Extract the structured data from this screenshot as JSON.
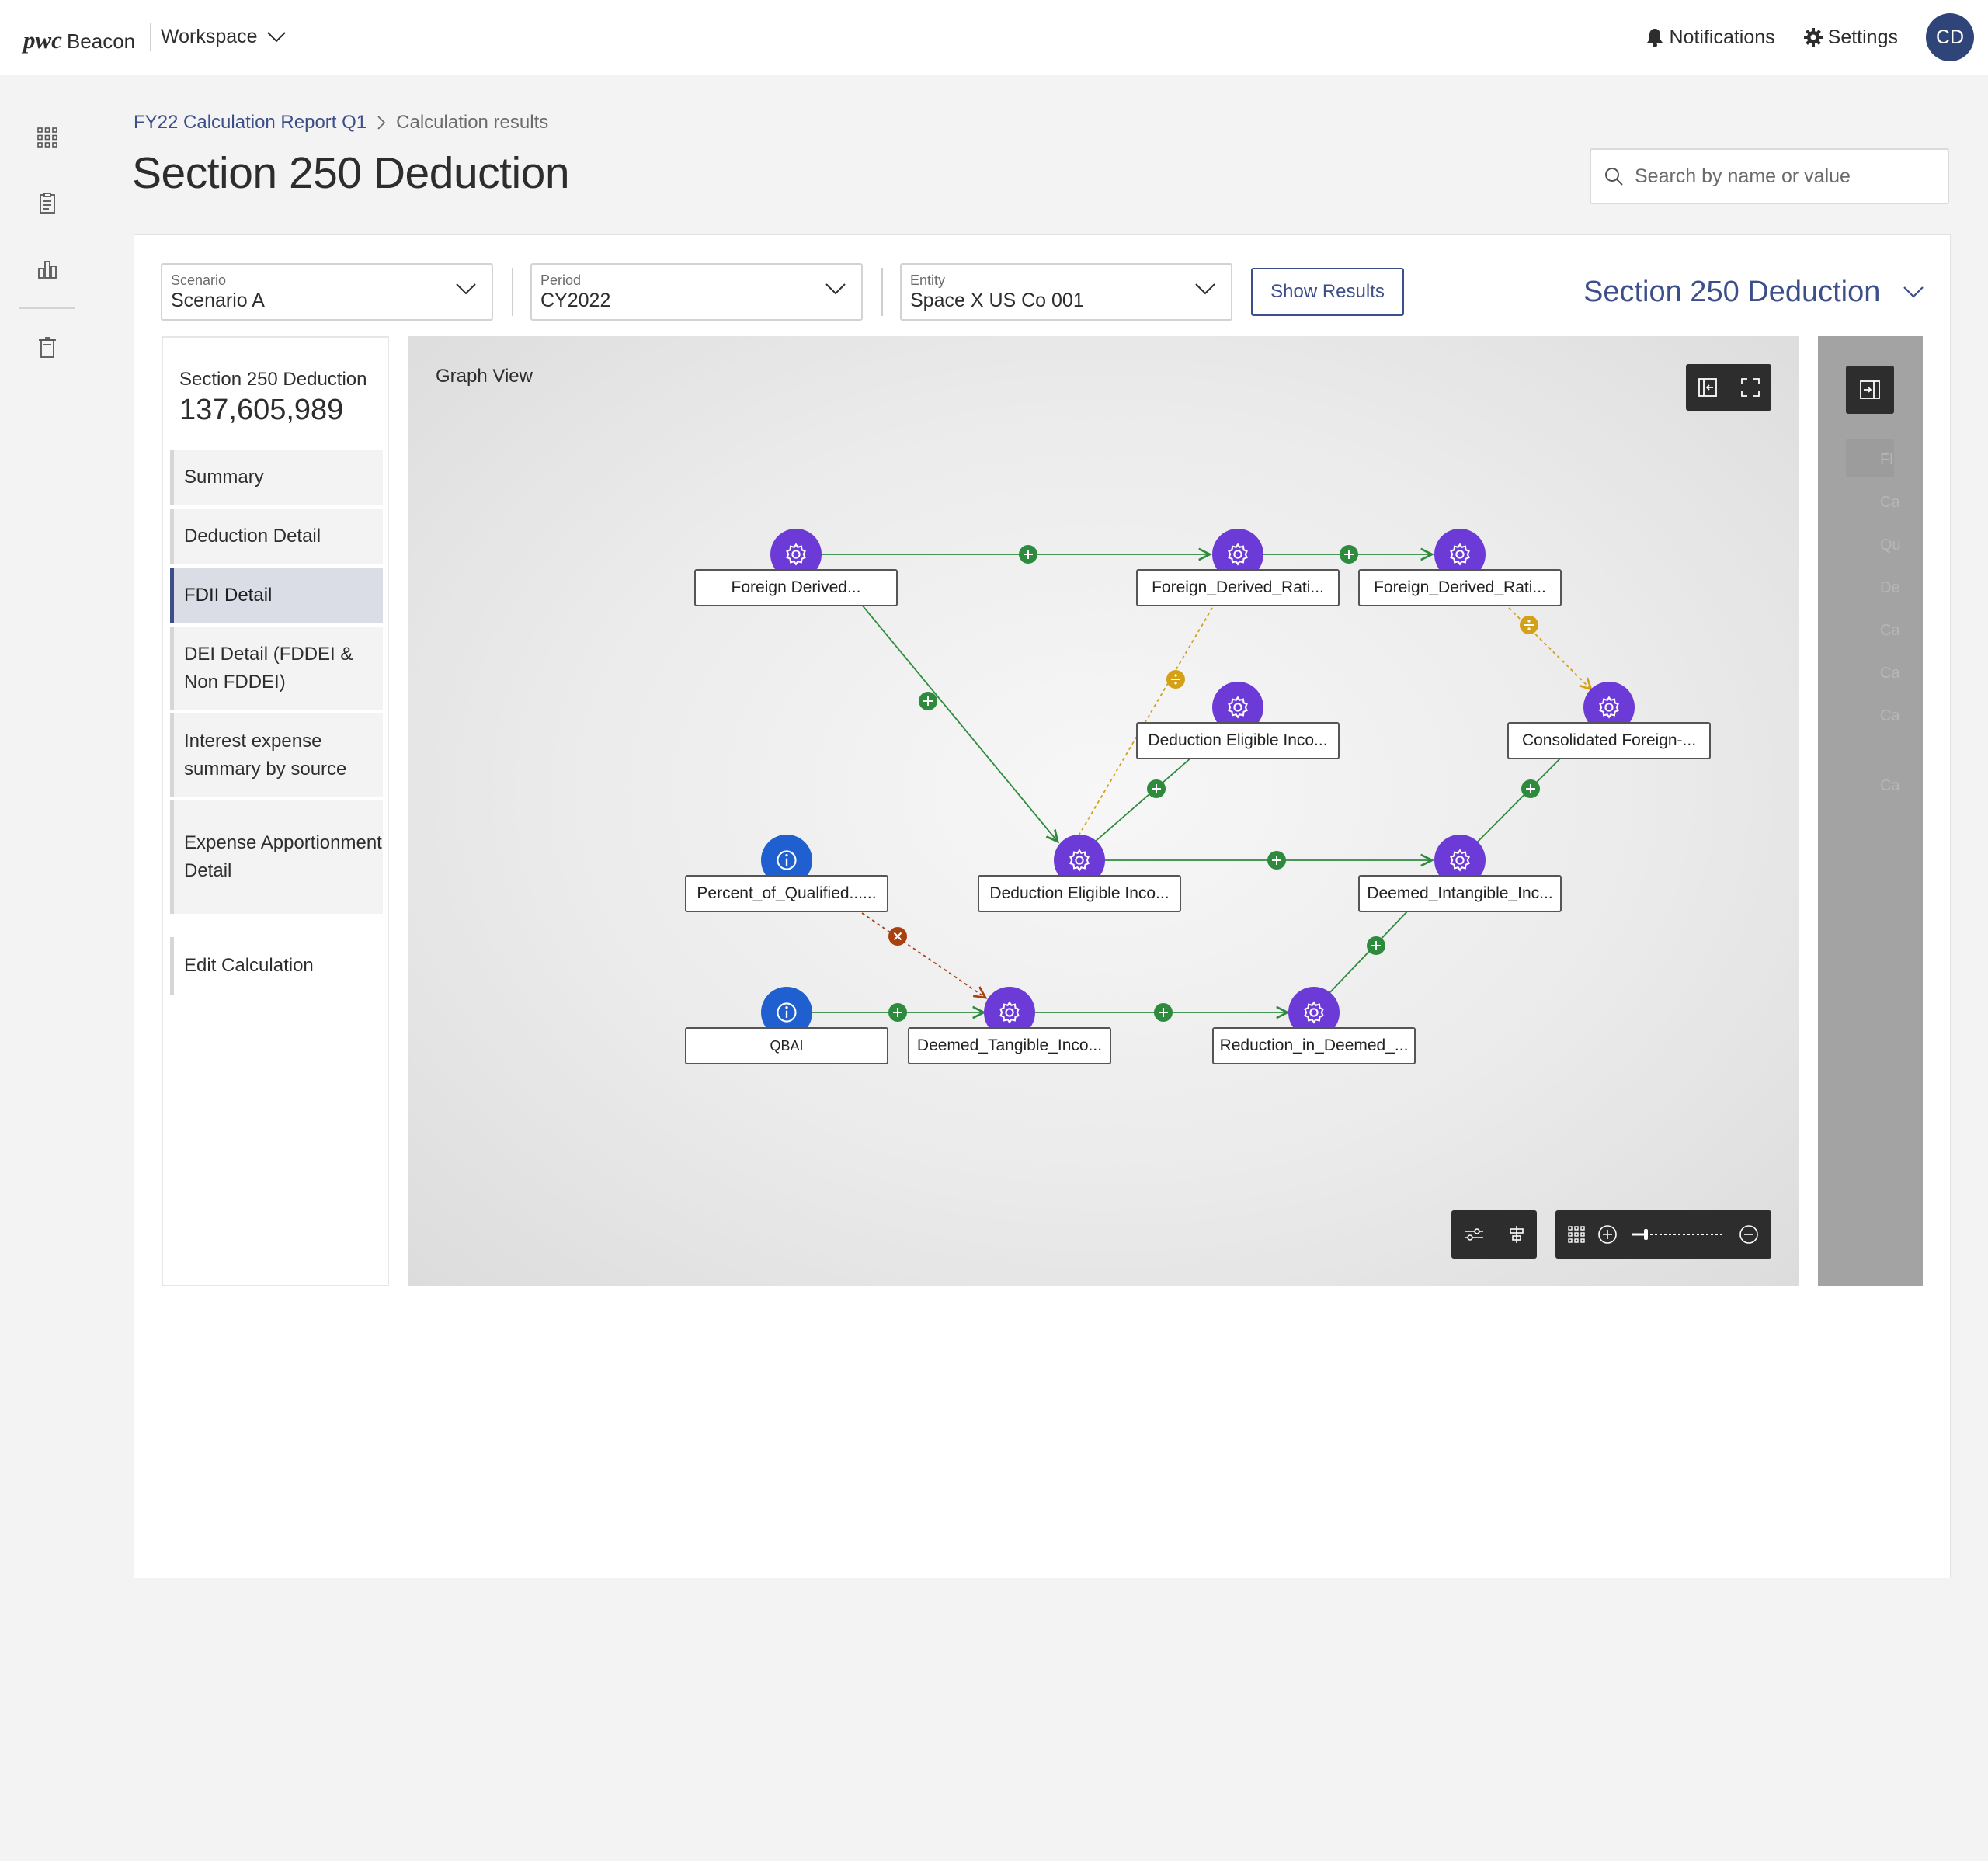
{
  "header": {
    "logo_pwc": "pwc",
    "logo_product": "Beacon",
    "workspace_label": "Workspace",
    "notifications_label": "Notifications",
    "settings_label": "Settings",
    "avatar_initials": "CD"
  },
  "rail": {
    "icons": [
      "apps-grid-icon",
      "document-icon",
      "bar-chart-icon",
      "trash-icon"
    ]
  },
  "breadcrumb": {
    "parent": "FY22 Calculation Report Q1",
    "current": "Calculation results"
  },
  "page_title": "Section 250 Deduction",
  "search": {
    "placeholder": "Search by name or value"
  },
  "filters": {
    "scenario": {
      "label": "Scenario",
      "value": "Scenario A"
    },
    "period": {
      "label": "Period",
      "value": "CY2022"
    },
    "entity": {
      "label": "Entity",
      "value": "Space X US Co 001"
    },
    "show_results_label": "Show Results",
    "section_select_value": "Section 250 Deduction"
  },
  "nav_panel": {
    "title": "Section 250 Deduction",
    "value": "137,605,989",
    "items": [
      {
        "label": "Summary"
      },
      {
        "label": "Deduction Detail"
      },
      {
        "label": "FDII Detail",
        "active": true
      },
      {
        "label": "DEI Detail (FDDEI & Non FDDEI)"
      },
      {
        "label": "Interest expense summary by source"
      },
      {
        "label": "Expense Apportionment Detail"
      }
    ],
    "edit_label": "Edit Calculation"
  },
  "graph": {
    "title": "Graph View",
    "nodes": [
      {
        "id": "n1",
        "label": "Foreign Derived...",
        "icon": "gear-icon"
      },
      {
        "id": "n2",
        "label": "Foreign_Derived_Rati...",
        "icon": "gear-icon"
      },
      {
        "id": "n3",
        "label": "Foreign_Derived_Rati...",
        "icon": "gear-icon"
      },
      {
        "id": "n4",
        "label": "Deduction Eligible Inco...",
        "icon": "gear-icon"
      },
      {
        "id": "n5",
        "label": "Consolidated Foreign-...",
        "icon": "gear-icon"
      },
      {
        "id": "n6",
        "label": "Percent_of_Qualified......",
        "icon": "info-icon"
      },
      {
        "id": "n7",
        "label": "Deduction Eligible Inco...",
        "icon": "gear-icon"
      },
      {
        "id": "n8",
        "label": "Deemed_Intangible_Inc...",
        "icon": "gear-icon"
      },
      {
        "id": "n9",
        "label": "QBAI",
        "icon": "info-icon"
      },
      {
        "id": "n10",
        "label": "Deemed_Tangible_Inco...",
        "icon": "gear-icon"
      },
      {
        "id": "n11",
        "label": "Reduction_in_Deemed_...",
        "icon": "gear-icon"
      }
    ],
    "edges": [
      {
        "from": "n1",
        "to": "n2",
        "op": "add"
      },
      {
        "from": "n2",
        "to": "n3",
        "op": "add"
      },
      {
        "from": "n1",
        "to": "n7",
        "op": "add"
      },
      {
        "from": "n7",
        "to": "n2",
        "op": "divide"
      },
      {
        "from": "n7",
        "to": "n4",
        "op": "add"
      },
      {
        "from": "n3",
        "to": "n5",
        "op": "divide"
      },
      {
        "from": "n7",
        "to": "n8",
        "op": "add"
      },
      {
        "from": "n8",
        "to": "n5",
        "op": "add"
      },
      {
        "from": "n6",
        "to": "n10",
        "op": "multiply"
      },
      {
        "from": "n9",
        "to": "n10",
        "op": "add"
      },
      {
        "from": "n10",
        "to": "n11",
        "op": "add"
      },
      {
        "from": "n11",
        "to": "n8",
        "op": "add"
      }
    ],
    "colors": {
      "node": "#6c3ad6",
      "input_node": "#1f5fcf",
      "add_edge": "#2e8b3e",
      "divide_edge": "#d4a017",
      "multiply_edge": "#a8400f"
    }
  },
  "right_panel": {
    "ghost_items": [
      "Fl",
      "Ca",
      "Qu",
      "De",
      "Ca",
      "Ca",
      "Ca",
      "Ca"
    ]
  }
}
